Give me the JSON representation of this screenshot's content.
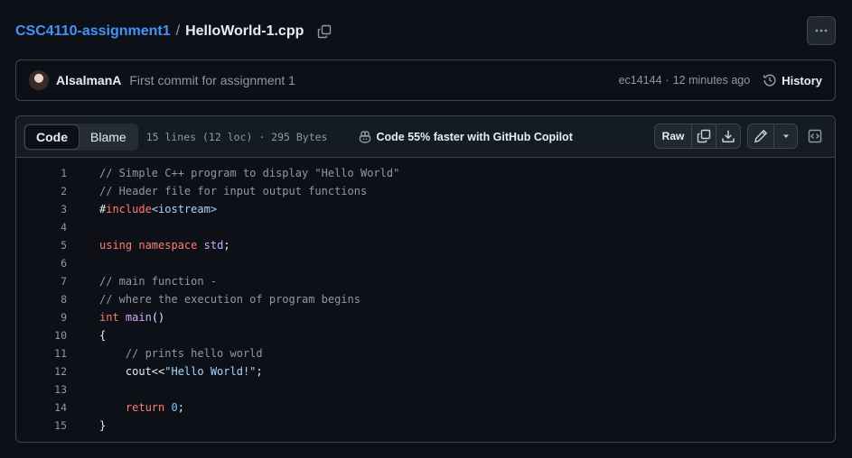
{
  "breadcrumb": {
    "repo": "CSC4110-assignment1",
    "separator": "/",
    "file": "HelloWorld-1.cpp"
  },
  "commit": {
    "author": "AlsalmanA",
    "message": "First commit for assignment 1",
    "hash": "ec14144",
    "separator": "·",
    "time": "12 minutes ago",
    "history_label": "History"
  },
  "file_header": {
    "tabs": [
      {
        "label": "Code",
        "active": true
      },
      {
        "label": "Blame",
        "active": false
      }
    ],
    "info": "15 lines (12 loc) · 295 Bytes",
    "copilot_label": "Code 55% faster with GitHub Copilot",
    "raw_label": "Raw"
  },
  "code_lines": [
    {
      "n": "1",
      "tokens": [
        {
          "t": "// Simple C++ program to display \"Hello World\"",
          "c": "c"
        }
      ]
    },
    {
      "n": "2",
      "tokens": [
        {
          "t": "// Header file for input output functions",
          "c": "c"
        }
      ]
    },
    {
      "n": "3",
      "tokens": [
        {
          "t": "#",
          "c": ""
        },
        {
          "t": "include",
          "c": "k"
        },
        {
          "t": "<iostream>",
          "c": "s"
        }
      ]
    },
    {
      "n": "4",
      "tokens": []
    },
    {
      "n": "5",
      "tokens": [
        {
          "t": "using",
          "c": "k"
        },
        {
          "t": " ",
          "c": ""
        },
        {
          "t": "namespace",
          "c": "k"
        },
        {
          "t": " ",
          "c": ""
        },
        {
          "t": "std",
          "c": "f"
        },
        {
          "t": ";",
          "c": ""
        }
      ]
    },
    {
      "n": "6",
      "tokens": []
    },
    {
      "n": "7",
      "tokens": [
        {
          "t": "// main function -",
          "c": "c"
        }
      ]
    },
    {
      "n": "8",
      "tokens": [
        {
          "t": "// where the execution of program begins",
          "c": "c"
        }
      ]
    },
    {
      "n": "9",
      "tokens": [
        {
          "t": "int",
          "c": "k"
        },
        {
          "t": " ",
          "c": ""
        },
        {
          "t": "main",
          "c": "f"
        },
        {
          "t": "()",
          "c": ""
        }
      ]
    },
    {
      "n": "10",
      "tokens": [
        {
          "t": "{",
          "c": ""
        }
      ]
    },
    {
      "n": "11",
      "tokens": [
        {
          "t": "    ",
          "c": ""
        },
        {
          "t": "// prints hello world",
          "c": "c"
        }
      ]
    },
    {
      "n": "12",
      "tokens": [
        {
          "t": "    cout<<",
          "c": ""
        },
        {
          "t": "\"Hello World!\"",
          "c": "s"
        },
        {
          "t": ";",
          "c": ""
        }
      ]
    },
    {
      "n": "13",
      "tokens": []
    },
    {
      "n": "14",
      "tokens": [
        {
          "t": "    ",
          "c": ""
        },
        {
          "t": "return",
          "c": "k"
        },
        {
          "t": " ",
          "c": ""
        },
        {
          "t": "0",
          "c": "n"
        },
        {
          "t": ";",
          "c": ""
        }
      ]
    },
    {
      "n": "15",
      "tokens": [
        {
          "t": "}",
          "c": ""
        }
      ]
    }
  ],
  "icons": {
    "copy_path": "copy-icon",
    "more": "kebab-horizontal-icon",
    "history": "history-icon",
    "copilot": "copilot-icon",
    "copy_raw": "copy-icon",
    "download": "download-icon",
    "edit": "pencil-icon",
    "edit_menu": "triangle-down-icon",
    "symbols": "code-square-icon"
  },
  "colors": {
    "background": "#0d1117",
    "link": "#4493f8",
    "comment": "#9198a1",
    "keyword": "#ff7b72",
    "string": "#a5d6ff",
    "entity": "#d2a8ff",
    "constant": "#79c0ff"
  }
}
